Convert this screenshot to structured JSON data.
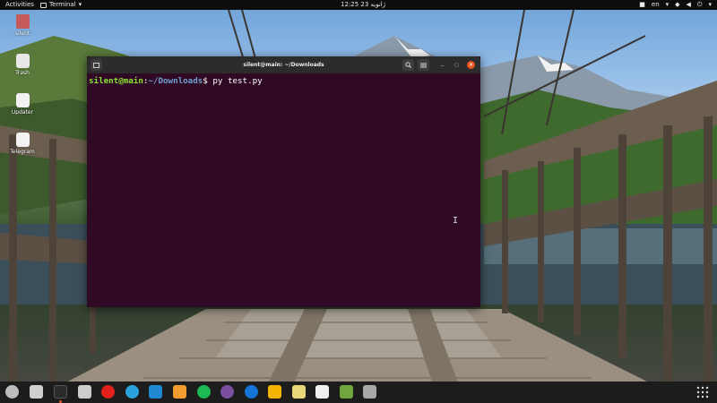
{
  "topbar": {
    "activities": "Activities",
    "app_menu_label": "Terminal",
    "clock": "12:25  23 ژانویه",
    "input_lang": "en"
  },
  "desktop_icons": [
    {
      "label": "silent",
      "icon": "home-folder-icon"
    },
    {
      "label": "Trash",
      "icon": "trash-icon"
    },
    {
      "label": "Updater",
      "icon": "updater-icon"
    },
    {
      "label": "Telegram",
      "icon": "telegram-icon"
    }
  ],
  "terminal": {
    "title": "silent@main: ~/Downloads",
    "prompt_user": "silent@main",
    "prompt_colon": ":",
    "prompt_path": "~/Downloads",
    "prompt_symbol": "$ ",
    "command": "py test.py"
  },
  "dock": [
    {
      "name": "show-apps",
      "color": "#bcbcbc"
    },
    {
      "name": "files",
      "color": "#cfcfcf"
    },
    {
      "name": "terminal",
      "color": "#2b2b2b"
    },
    {
      "name": "screenshot",
      "color": "#cccccc"
    },
    {
      "name": "opera",
      "color": "#e2211c"
    },
    {
      "name": "telegram",
      "color": "#2aa3dd"
    },
    {
      "name": "vscode",
      "color": "#1f8ad2"
    },
    {
      "name": "sublime-text",
      "color": "#f39c2f"
    },
    {
      "name": "spotify",
      "color": "#1db954"
    },
    {
      "name": "github-desktop",
      "color": "#7b4fa0"
    },
    {
      "name": "app-blue",
      "color": "#1674d6"
    },
    {
      "name": "text-editor",
      "color": "#f5b400"
    },
    {
      "name": "notes",
      "color": "#e9d87a"
    },
    {
      "name": "updater",
      "color": "#f0f0f0"
    },
    {
      "name": "android-sdk",
      "color": "#6fa640"
    },
    {
      "name": "blank-app",
      "color": "#a8a8a8"
    }
  ]
}
